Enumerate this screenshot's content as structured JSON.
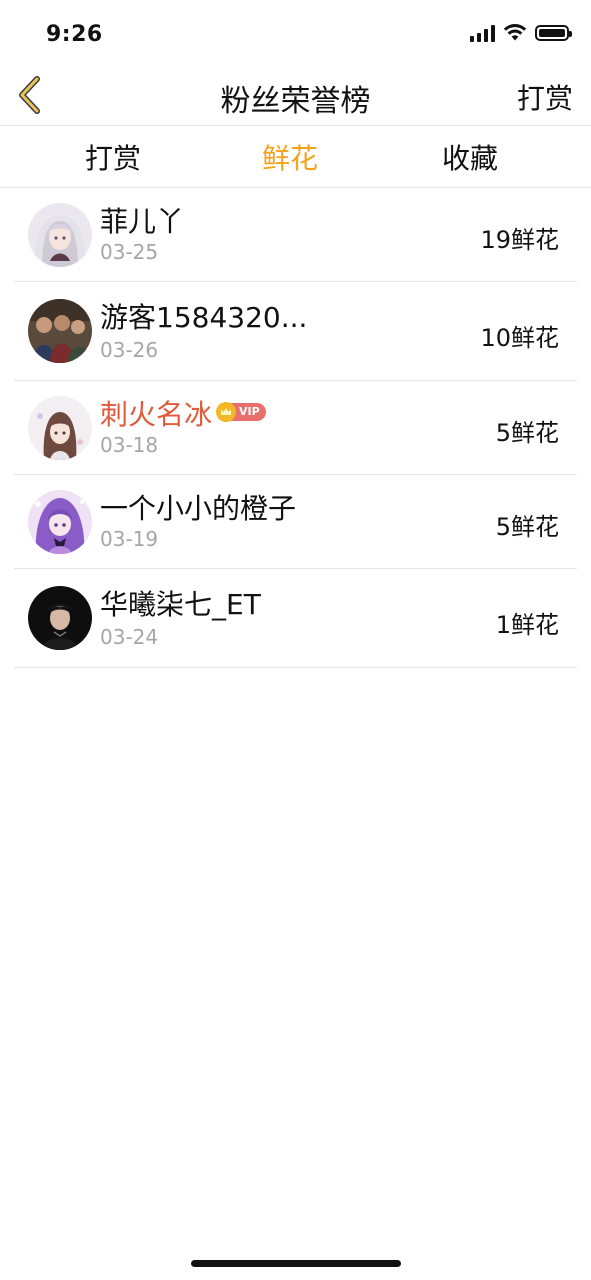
{
  "status_bar": {
    "time": "9:26"
  },
  "nav": {
    "title": "粉丝荣誉榜",
    "right_label": "打赏"
  },
  "tabs": [
    {
      "label": "打赏",
      "active": false
    },
    {
      "label": "鲜花",
      "active": true
    },
    {
      "label": "收藏",
      "active": false
    }
  ],
  "colors": {
    "accent": "#f3a21c",
    "vip_name": "#e05a3b",
    "date": "#a6a6a6",
    "divider": "#e6e6e6"
  },
  "list": [
    {
      "name": "菲儿丫",
      "date": "03-25",
      "count": "19鲜花",
      "vip": false
    },
    {
      "name": "游客1584320...",
      "date": "03-26",
      "count": "10鲜花",
      "vip": false
    },
    {
      "name": "刺火名冰",
      "date": "03-18",
      "count": "5鲜花",
      "vip": true,
      "vip_badge": "VIP"
    },
    {
      "name": "一个小小的橙子",
      "date": "03-19",
      "count": "5鲜花",
      "vip": false
    },
    {
      "name": "华曦柒七_ET",
      "date": "03-24",
      "count": "1鲜花",
      "vip": false
    }
  ]
}
